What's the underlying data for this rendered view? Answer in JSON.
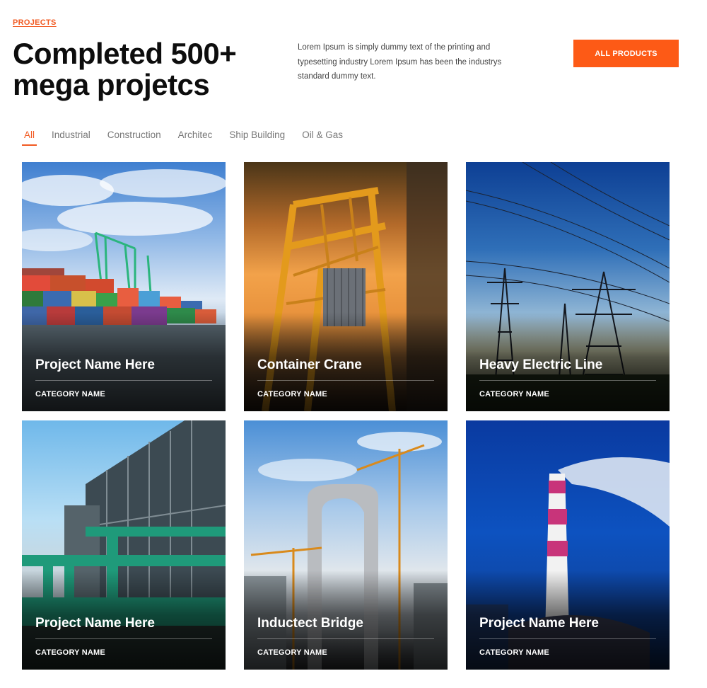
{
  "section": {
    "eyebrow": "PROJECTS",
    "headline_line1": "Completed 500+",
    "headline_line2": "mega projetcs",
    "intro_line1": "Lorem Ipsum is simply dummy text of the printing and",
    "intro_line2": "typesetting industry Lorem Ipsum has been the industrys",
    "intro_line3": "standard dummy text.",
    "cta_label": "ALL PRODUCTS"
  },
  "filters": [
    {
      "label": "All",
      "active": true
    },
    {
      "label": "Industrial",
      "active": false
    },
    {
      "label": "Construction",
      "active": false
    },
    {
      "label": "Architec",
      "active": false
    },
    {
      "label": "Ship Building",
      "active": false
    },
    {
      "label": "Oil & Gas",
      "active": false
    }
  ],
  "projects": [
    {
      "title": "Project Name Here",
      "category": "CATEGORY NAME",
      "image": "container-port-photo"
    },
    {
      "title": "Container Crane",
      "category": "CATEGORY NAME",
      "image": "container-crane-photo"
    },
    {
      "title": "Heavy Electric Line",
      "category": "CATEGORY NAME",
      "image": "power-lines-photo"
    },
    {
      "title": "Project Name Here",
      "category": "CATEGORY NAME",
      "image": "industrial-pipes-photo"
    },
    {
      "title": "Inductect Bridge",
      "category": "CATEGORY NAME",
      "image": "bridge-construction-photo"
    },
    {
      "title": "Project Name Here",
      "category": "CATEGORY NAME",
      "image": "smokestack-photo"
    }
  ],
  "colors": {
    "accent": "#f15a22",
    "cta_background": "#fd5a16",
    "headline": "#0d0d0d",
    "tab_inactive": "#777777"
  }
}
